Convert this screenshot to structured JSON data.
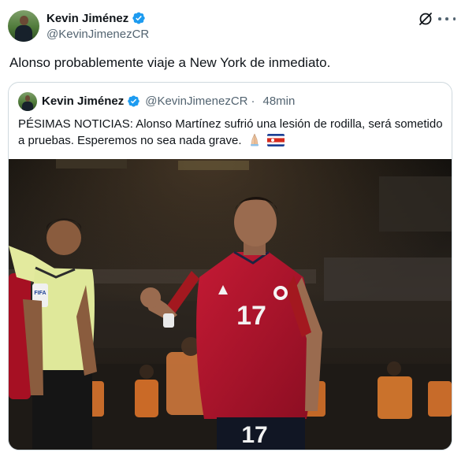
{
  "post": {
    "author_name": "Kevin Jiménez",
    "author_handle": "@KevinJimenezCR",
    "text": "Alonso probablemente viaje a New York de inmediato."
  },
  "quoted": {
    "author_name": "Kevin Jiménez",
    "author_handle": "@KevinJimenezCR",
    "time": "48min",
    "separator": "·",
    "text": "PÉSIMAS NOTICIAS: Alonso Martínez sufrió una lesión de rodilla, será sometido a pruebas. Esperemos no sea nada grave.",
    "emoji": [
      "praying-hands-emoji",
      "costa-rica-flag-emoji"
    ]
  },
  "photo": {
    "player_number": "17",
    "referee_badge": "FIFA"
  },
  "icons": [
    "avatar",
    "verified-badge-icon",
    "grok-icon",
    "more-icon"
  ],
  "colors": {
    "verified": "#1d9bf0",
    "text": "#0f1419",
    "muted": "#536471",
    "border": "#cfd9de",
    "jersey": "#b0102c"
  }
}
